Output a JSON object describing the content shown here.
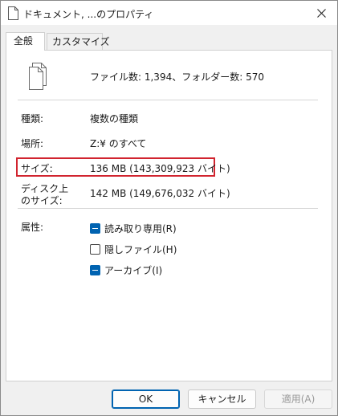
{
  "window": {
    "title": "ドキュメント, ...のプロパティ",
    "close_icon": "close-icon"
  },
  "tabs": [
    {
      "label": "全般",
      "active": true
    },
    {
      "label": "カスタマイズ",
      "active": false
    }
  ],
  "summary": {
    "icon": "multiple-files-icon",
    "text": "ファイル数: 1,394、フォルダー数: 570"
  },
  "properties": {
    "type_label": "種類:",
    "type_value": "複数の種類",
    "location_label": "場所:",
    "location_value": "Z:¥ のすべて",
    "size_label": "サイズ:",
    "size_value": "136 MB (143,309,923 バイト)",
    "disk_size_label_1": "ディスク上",
    "disk_size_label_2": "のサイズ:",
    "disk_size_value": "142 MB (149,676,032 バイト)"
  },
  "attributes": {
    "label": "属性:",
    "items": [
      {
        "label": "読み取り専用(R)",
        "state": "indeterminate"
      },
      {
        "label": "隠しファイル(H)",
        "state": "unchecked"
      },
      {
        "label": "アーカイブ(I)",
        "state": "indeterminate"
      }
    ]
  },
  "buttons": {
    "ok": "OK",
    "cancel": "キャンセル",
    "apply": "適用(A)"
  },
  "colors": {
    "accent": "#0063b1",
    "highlight_box": "#d1242f"
  }
}
